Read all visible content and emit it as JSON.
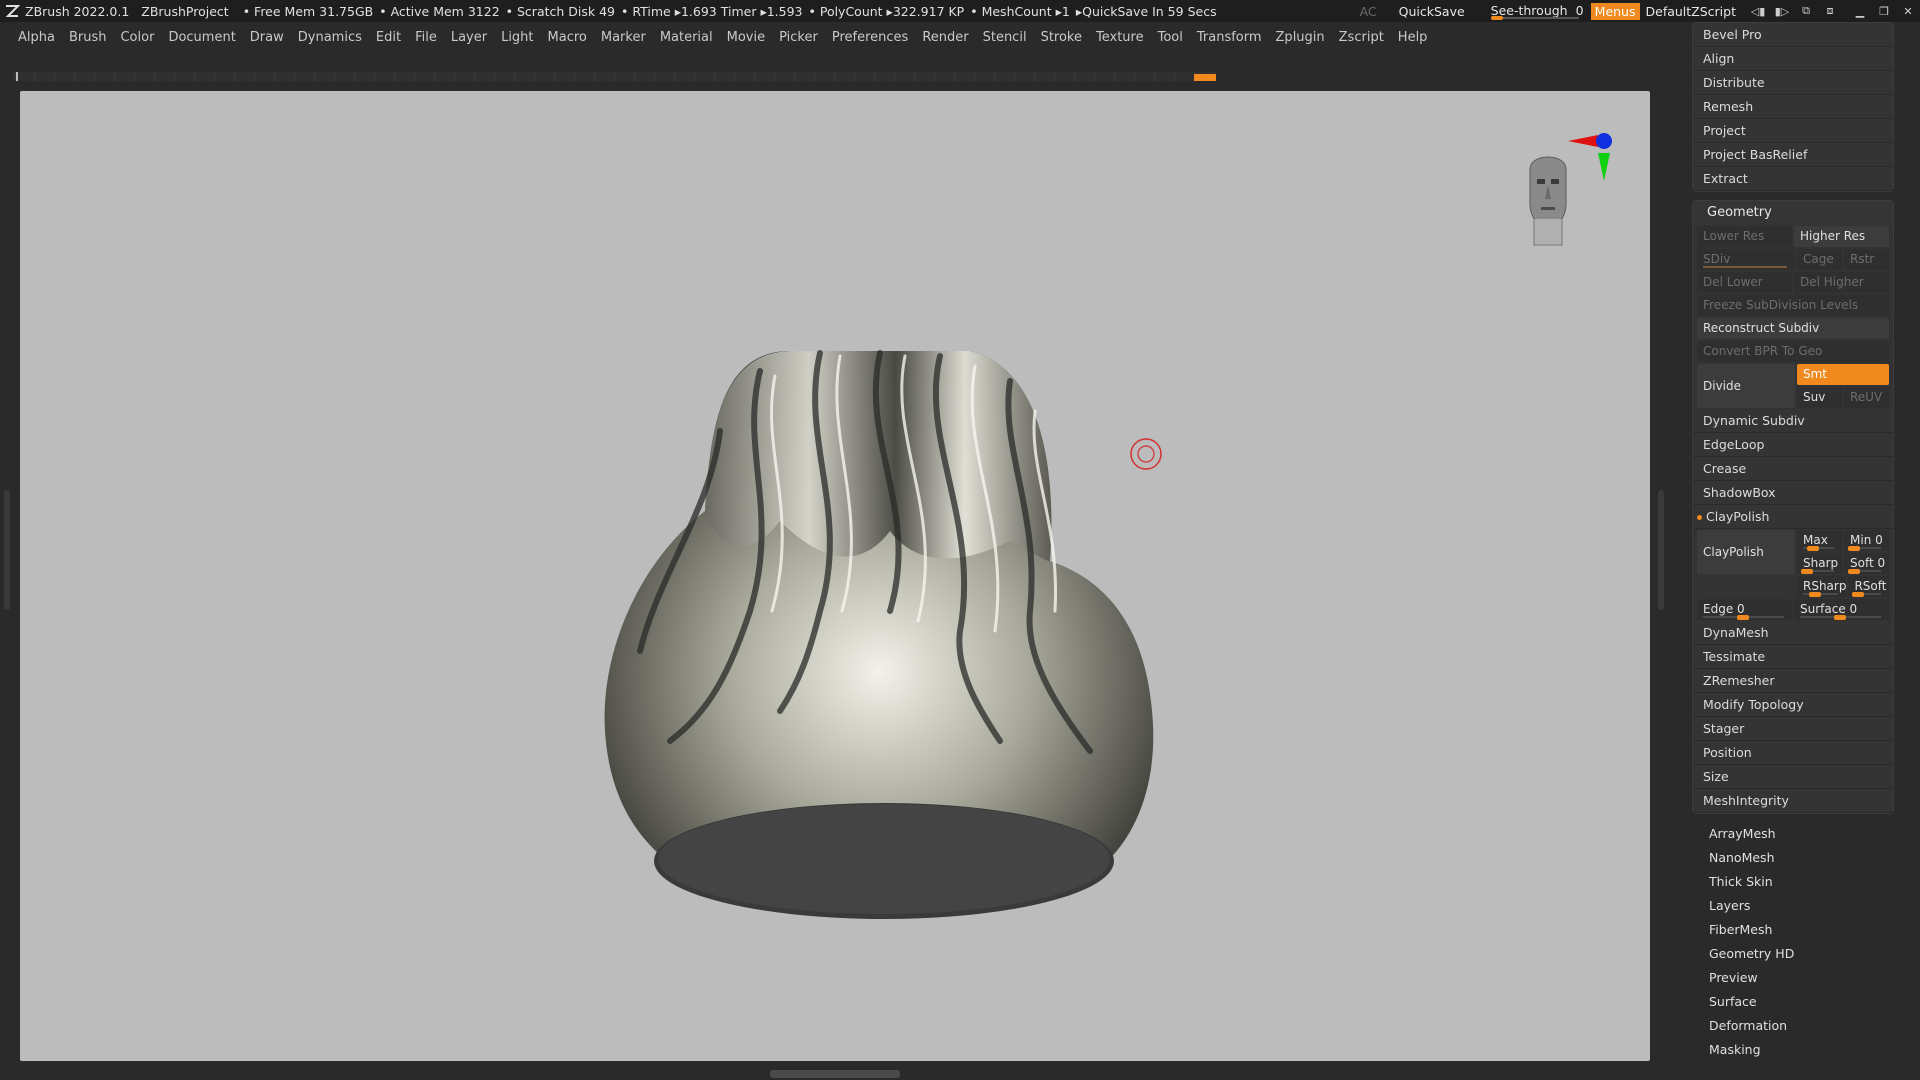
{
  "titlebar": {
    "app": "ZBrush 2022.0.1",
    "project": "ZBrushProject",
    "free_mem": "• Free Mem 31.75GB",
    "active_mem": "• Active Mem 3122",
    "scratch": "• Scratch Disk 49",
    "rtime": "• RTime ▸1.693 Timer ▸1.593",
    "polycount": "• PolyCount ▸322.917 KP",
    "meshcount": "• MeshCount ▸1",
    "quicksave_in": "▸QuickSave In 59 Secs",
    "ac": "AC",
    "quicksave": "QuickSave",
    "see_through_label": "See-through",
    "see_through_value": "0",
    "see_through_level": 0,
    "menus": "Menus",
    "script": "DefaultZScript"
  },
  "menubar": [
    "Alpha",
    "Brush",
    "Color",
    "Document",
    "Draw",
    "Dynamics",
    "Edit",
    "File",
    "Layer",
    "Light",
    "Macro",
    "Marker",
    "Material",
    "Movie",
    "Picker",
    "Preferences",
    "Render",
    "Stencil",
    "Stroke",
    "Texture",
    "Tool",
    "Transform",
    "Zplugin",
    "Zscript",
    "Help"
  ],
  "top_buttons": [
    "Bevel Pro",
    "Align",
    "Distribute",
    "Remesh",
    "Project",
    "Project BasRelief",
    "Extract"
  ],
  "geometry": {
    "header": "Geometry",
    "lower_res": "Lower Res",
    "higher_res": "Higher Res",
    "sdiv": "SDiv",
    "cage": "Cage",
    "rstr": "Rstr",
    "del_lower": "Del Lower",
    "del_higher": "Del Higher",
    "freeze": "Freeze SubDivision Levels",
    "reconstruct": "Reconstruct Subdiv",
    "convert_bpr": "Convert BPR To Geo",
    "divide": "Divide",
    "smt": "Smt",
    "suv": "Suv",
    "reuv": "ReUV",
    "dynamic_subdiv": "Dynamic Subdiv",
    "edgeloop": "EdgeLoop",
    "crease": "Crease",
    "shadowbox": "ShadowBox",
    "claypolish_header": "ClayPolish",
    "claypolish_btn": "ClayPolish",
    "max": "Max 25",
    "min": "Min 0",
    "sharp": "Sharp",
    "soft": "Soft 0",
    "rsharp": "RSharp",
    "rsoft": "RSoft 5",
    "edge": "Edge 0",
    "surface": "Surface 0",
    "after": [
      "DynaMesh",
      "Tessimate",
      "ZRemesher",
      "Modify Topology",
      "Stager",
      "Position",
      "Size",
      "MeshIntegrity"
    ]
  },
  "subpalettes": [
    "ArrayMesh",
    "NanoMesh",
    "Thick Skin",
    "Layers",
    "FiberMesh",
    "Geometry HD",
    "Preview",
    "Surface",
    "Deformation",
    "Masking"
  ],
  "colors": {
    "accent": "#f0891e",
    "viewport_bg": "#bcbcbc",
    "panel_bg": "#333333"
  },
  "icons": [
    "zbrush-logo-icon",
    "navigation-head-icon",
    "axis-gizmo-icon",
    "brush-cursor-icon"
  ]
}
